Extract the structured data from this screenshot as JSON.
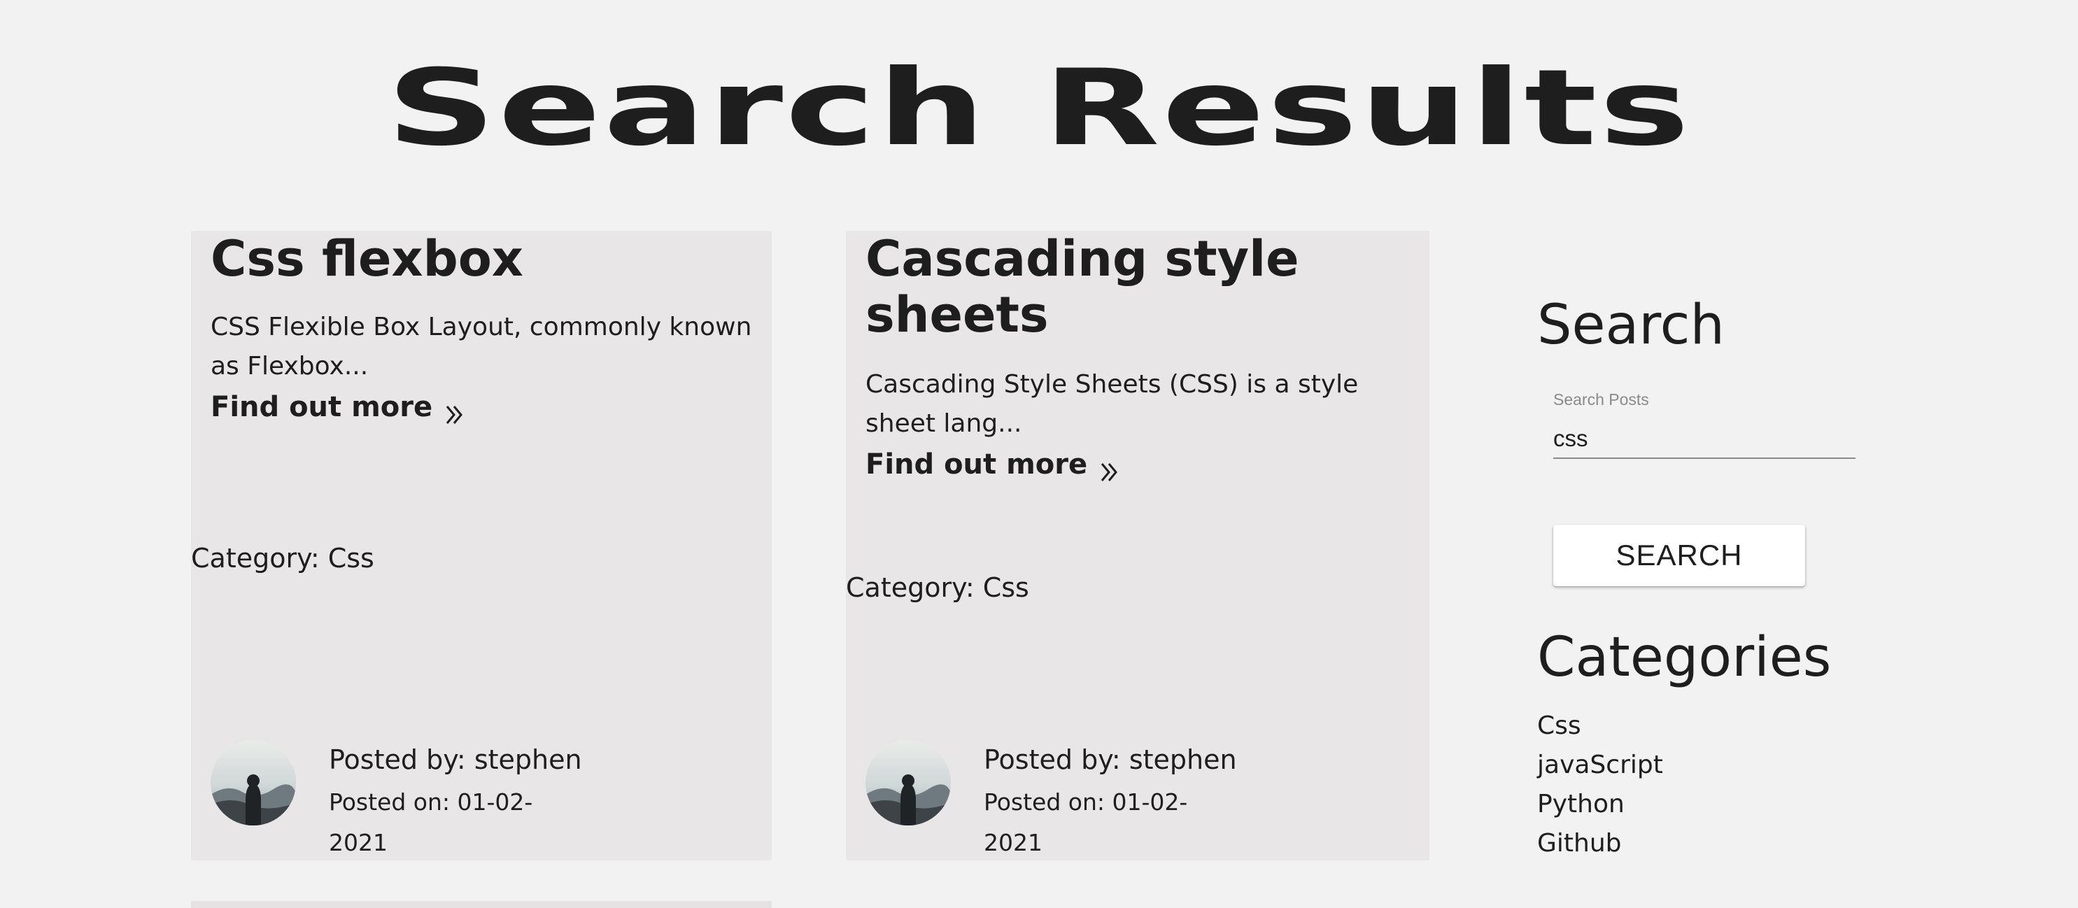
{
  "page": {
    "title": "Search Results"
  },
  "posts": [
    {
      "title": "Css flexbox",
      "excerpt": "CSS Flexible Box Layout, commonly known as Flexbox...",
      "find_more": "Find out more",
      "category": "Category: Css",
      "posted_by": "Posted by: stephen",
      "posted_on": "Posted on: 01-02-2021"
    },
    {
      "title": "Cascading style sheets",
      "excerpt": "Cascading Style Sheets (CSS) is a style sheet lang...",
      "find_more": "Find out more",
      "category": "Category: Css",
      "posted_by": "Posted by: stephen",
      "posted_on": "Posted on: 01-02-2021"
    }
  ],
  "sidebar": {
    "search_heading": "Search",
    "search_label": "Search Posts",
    "search_value": "css",
    "search_button": "SEARCH",
    "categories_heading": "Categories",
    "categories": [
      "Css",
      "javaScript",
      "Python",
      "Github"
    ]
  },
  "icons": {
    "find_more": "double-chevron-right-icon",
    "avatar": "avatar-image"
  }
}
